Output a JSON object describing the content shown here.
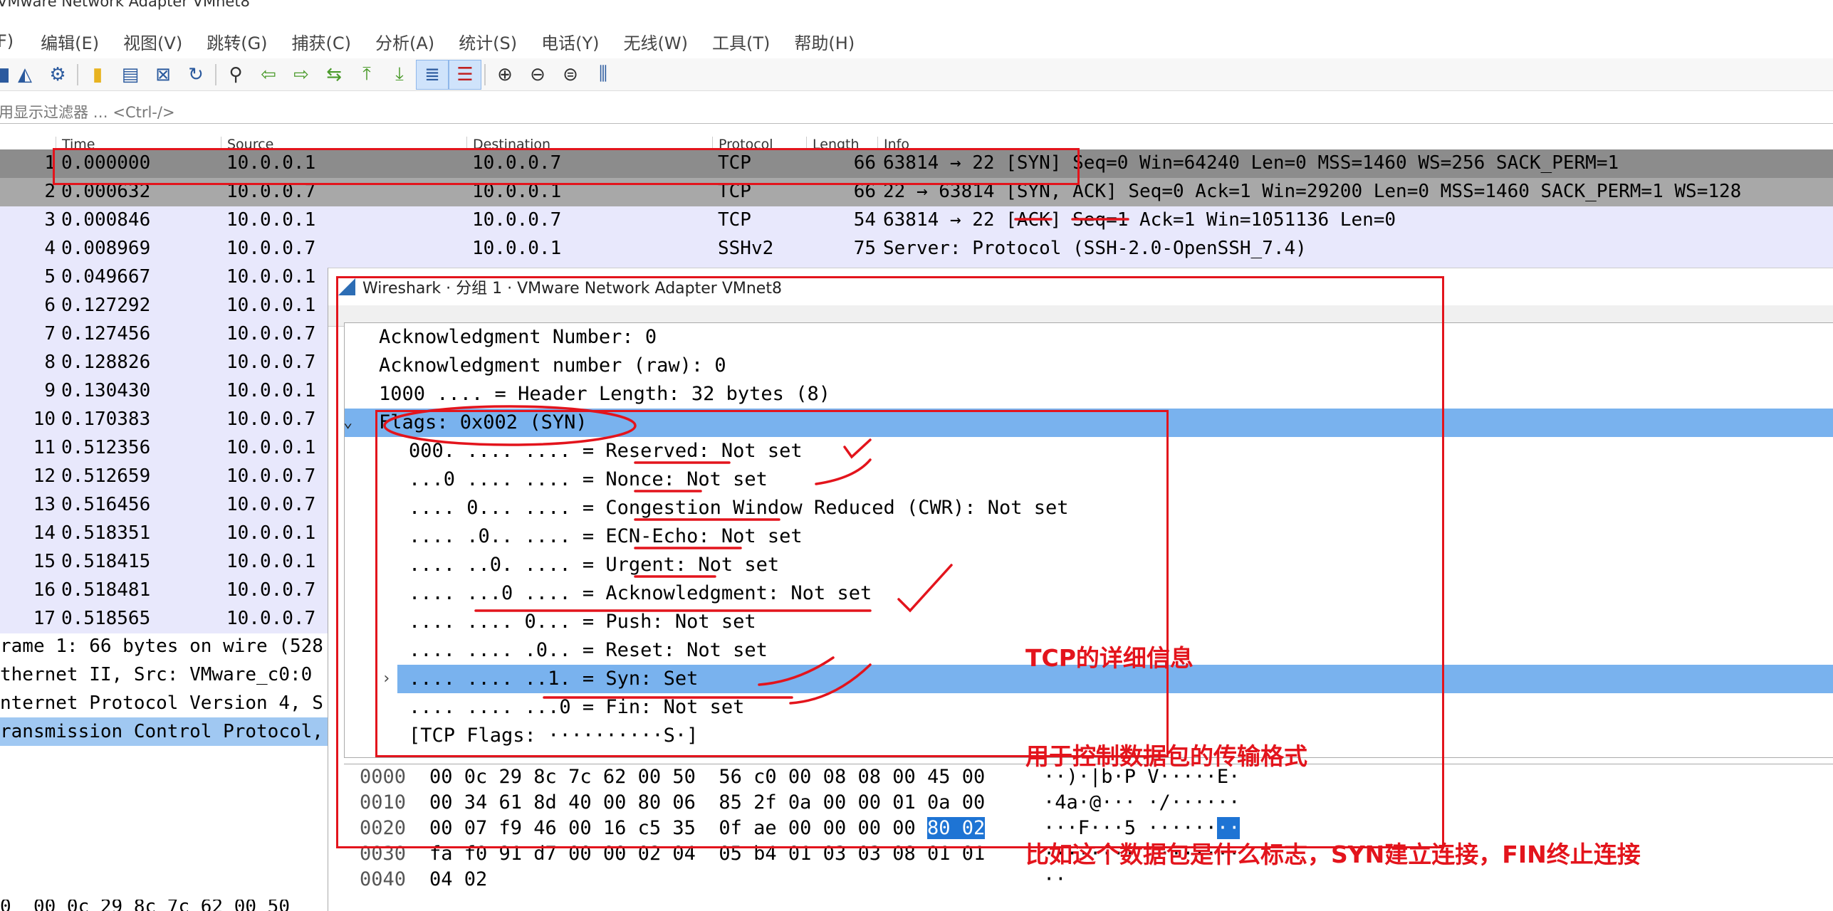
{
  "window": {
    "title": "VMware Network Adapter VMnet8"
  },
  "menu": [
    "F)",
    "编辑(E)",
    "视图(V)",
    "跳转(G)",
    "捕获(C)",
    "分析(A)",
    "统计(S)",
    "电话(Y)",
    "无线(W)",
    "工具(T)",
    "帮助(H)"
  ],
  "filter": {
    "placeholder": "用显示过滤器 … <Ctrl-/>"
  },
  "columns": {
    "no": "",
    "time": "Time",
    "source": "Source",
    "destination": "Destination",
    "protocol": "Protocol",
    "length": "Length",
    "info": "Info"
  },
  "packets": [
    {
      "no": "1",
      "time": "0.000000",
      "src": "10.0.0.1",
      "dst": "10.0.0.7",
      "proto": "TCP",
      "len": "66",
      "info": "63814 → 22 [SYN] Seq=0 Win=64240 Len=0 MSS=1460 WS=256 SACK_PERM=1"
    },
    {
      "no": "2",
      "time": "0.000632",
      "src": "10.0.0.7",
      "dst": "10.0.0.1",
      "proto": "TCP",
      "len": "66",
      "info": "22 → 63814 [SYN, ACK] Seq=0 Ack=1 Win=29200 Len=0 MSS=1460 SACK_PERM=1 WS=128"
    },
    {
      "no": "3",
      "time": "0.000846",
      "src": "10.0.0.1",
      "dst": "10.0.0.7",
      "proto": "TCP",
      "len": "54",
      "info": "63814 → 22 [ACK] Seq=1 Ack=1 Win=1051136 Len=0"
    },
    {
      "no": "4",
      "time": "0.008969",
      "src": "10.0.0.7",
      "dst": "10.0.0.1",
      "proto": "SSHv2",
      "len": "75",
      "info": "Server: Protocol (SSH-2.0-OpenSSH_7.4)"
    },
    {
      "no": "5",
      "time": "0.049667",
      "src": "10.0.0.1",
      "dst": "",
      "proto": "",
      "len": "",
      "info": ""
    },
    {
      "no": "6",
      "time": "0.127292",
      "src": "10.0.0.1",
      "dst": "",
      "proto": "",
      "len": "",
      "info": ""
    },
    {
      "no": "7",
      "time": "0.127456",
      "src": "10.0.0.7",
      "dst": "",
      "proto": "",
      "len": "",
      "info": ""
    },
    {
      "no": "8",
      "time": "0.128826",
      "src": "10.0.0.7",
      "dst": "",
      "proto": "",
      "len": "",
      "info": ""
    },
    {
      "no": "9",
      "time": "0.130430",
      "src": "10.0.0.1",
      "dst": "",
      "proto": "",
      "len": "",
      "info": ""
    },
    {
      "no": "10",
      "time": "0.170383",
      "src": "10.0.0.7",
      "dst": "",
      "proto": "",
      "len": "",
      "info": ""
    },
    {
      "no": "11",
      "time": "0.512356",
      "src": "10.0.0.1",
      "dst": "",
      "proto": "",
      "len": "",
      "info": ""
    },
    {
      "no": "12",
      "time": "0.512659",
      "src": "10.0.0.7",
      "dst": "",
      "proto": "",
      "len": "",
      "info": ""
    },
    {
      "no": "13",
      "time": "0.516456",
      "src": "10.0.0.7",
      "dst": "",
      "proto": "",
      "len": "",
      "info": ""
    },
    {
      "no": "14",
      "time": "0.518351",
      "src": "10.0.0.1",
      "dst": "",
      "proto": "",
      "len": "",
      "info": ""
    },
    {
      "no": "15",
      "time": "0.518415",
      "src": "10.0.0.1",
      "dst": "",
      "proto": "",
      "len": "",
      "info": ""
    },
    {
      "no": "16",
      "time": "0.518481",
      "src": "10.0.0.7",
      "dst": "",
      "proto": "",
      "len": "",
      "info": ""
    },
    {
      "no": "17",
      "time": "0.518565",
      "src": "10.0.0.7",
      "dst": "",
      "proto": "",
      "len": "",
      "info": ""
    }
  ],
  "left_detail": [
    "rame 1: 66 bytes on wire (528",
    "thernet II, Src: VMware_c0:0",
    "nternet Protocol Version 4, S",
    "ransmission Control Protocol,"
  ],
  "left_hex": "0  00 0c 29 8c 7c 62 00 50",
  "dialog": {
    "title": "Wireshark · 分组 1 · VMware Network Adapter VMnet8",
    "tree": [
      "Acknowledgment Number: 0",
      "Acknowledgment number (raw): 0",
      "1000 .... = Header Length: 32 bytes (8)",
      "Flags: 0x002 (SYN)",
      "000. .... .... = Reserved: Not set",
      "...0 .... .... = Nonce: Not set",
      ".... 0... .... = Congestion Window Reduced (CWR): Not set",
      ".... .0.. .... = ECN-Echo: Not set",
      ".... ..0. .... = Urgent: Not set",
      ".... ...0 .... = Acknowledgment: Not set",
      ".... .... 0... = Push: Not set",
      ".... .... .0.. = Reset: Not set",
      ".... .... ..1. = Syn: Set",
      ".... .... ...0 = Fin: Not set",
      "[TCP Flags: ··········S·]"
    ],
    "hex": [
      {
        "off": "0000",
        "bytes": "00 0c 29 8c 7c 62 00 50  56 c0 00 08 08 00 45 00",
        "ascii": "··)·|b·P V·····E·"
      },
      {
        "off": "0010",
        "bytes": "00 34 61 8d 40 00 80 06  85 2f 0a 00 00 01 0a 00",
        "ascii": "·4a·@··· ·/······"
      },
      {
        "off": "0020",
        "bytes_pre": "00 07 f9 46 00 16 c5 35  0f ae 00 00 00 00 ",
        "bytes_sel": "80 02",
        "ascii_pre": "···F···5 ······",
        "ascii_sel": "··"
      },
      {
        "off": "0030",
        "bytes": "fa f0 91 d7 00 00 02 04  05 b4 01 03 03 08 01 01",
        "ascii": "········ ········"
      },
      {
        "off": "0040",
        "bytes": "04 02",
        "ascii": "··"
      }
    ]
  },
  "annotation": {
    "lines": [
      "TCP的详细信息",
      "用于控制数据包的传输格式",
      "比如这个数据包是什么标志，SYN建立连接，FIN终止连接"
    ]
  },
  "colors": {
    "annotation_red": "#e3141c",
    "selection_blue": "#79b2ee",
    "tcp_row": "#e8e8fc"
  }
}
